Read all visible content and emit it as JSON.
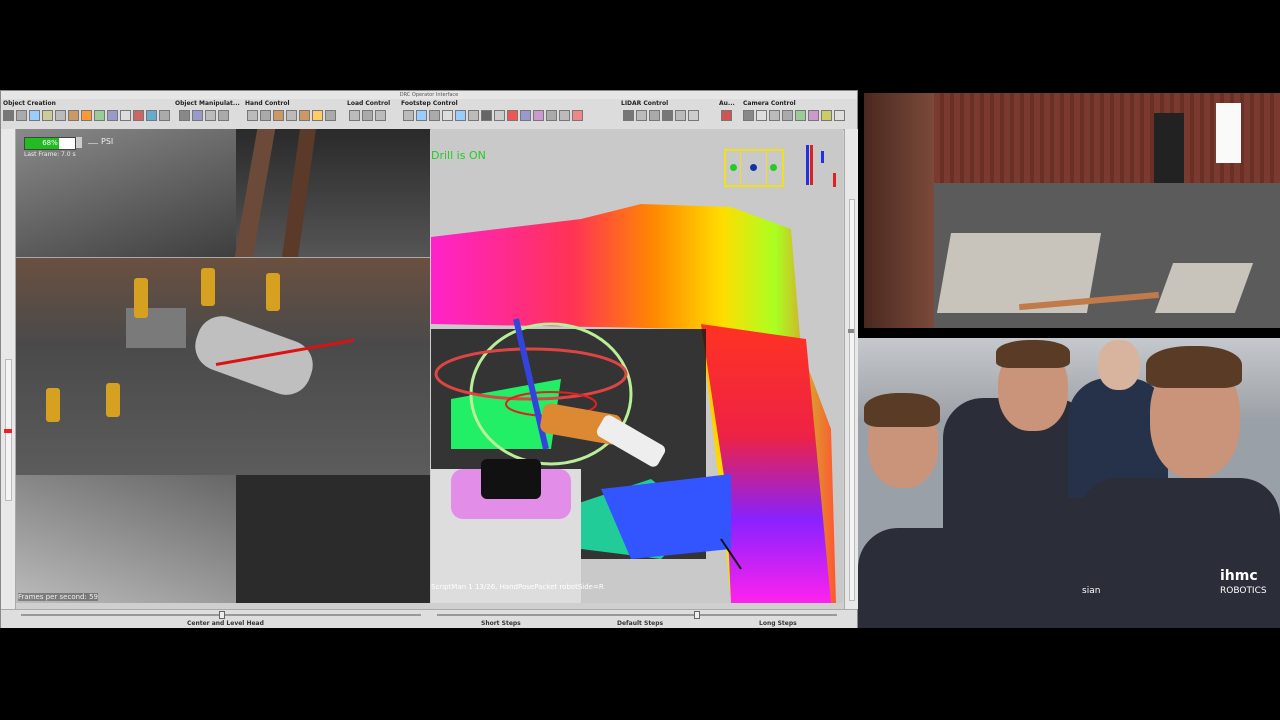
{
  "window": {
    "title": "DRC Operator Interface"
  },
  "toolbar": {
    "groups": [
      {
        "label": "Object Creation"
      },
      {
        "label": "Object Manipulat..."
      },
      {
        "label": "Hand Control"
      },
      {
        "label": "Load Control"
      },
      {
        "label": "Footstep Control"
      },
      {
        "label": "LIDAR Control"
      },
      {
        "label": "Au..."
      },
      {
        "label": "Camera Control"
      }
    ]
  },
  "left_view": {
    "battery_percent_label": "68%",
    "battery_level": 0.68,
    "psi_label": "PSI",
    "last_frame": "Last Frame: 7.0 s",
    "fps": "Frames per second: 59"
  },
  "center_view": {
    "status": "Drill is ON",
    "status_color": "#22cc22",
    "script_status": "ScriptMan    1 13/26, HandPosePacket robotSide=R"
  },
  "bottom_bar": {
    "center_level_head": "Center and Level Head",
    "short_steps": "Short Steps",
    "default_steps": "Default Steps",
    "long_steps": "Long Steps"
  },
  "camera_bottom": {
    "shirt_logo": "ihmc",
    "shirt_logo_sub": "ROBOTICS",
    "sponsor_fragment": "sian"
  },
  "colors": {
    "accent_green": "#22cc22",
    "arrow_red": "#dd1111",
    "indicator_yellow": "#f0e020"
  }
}
